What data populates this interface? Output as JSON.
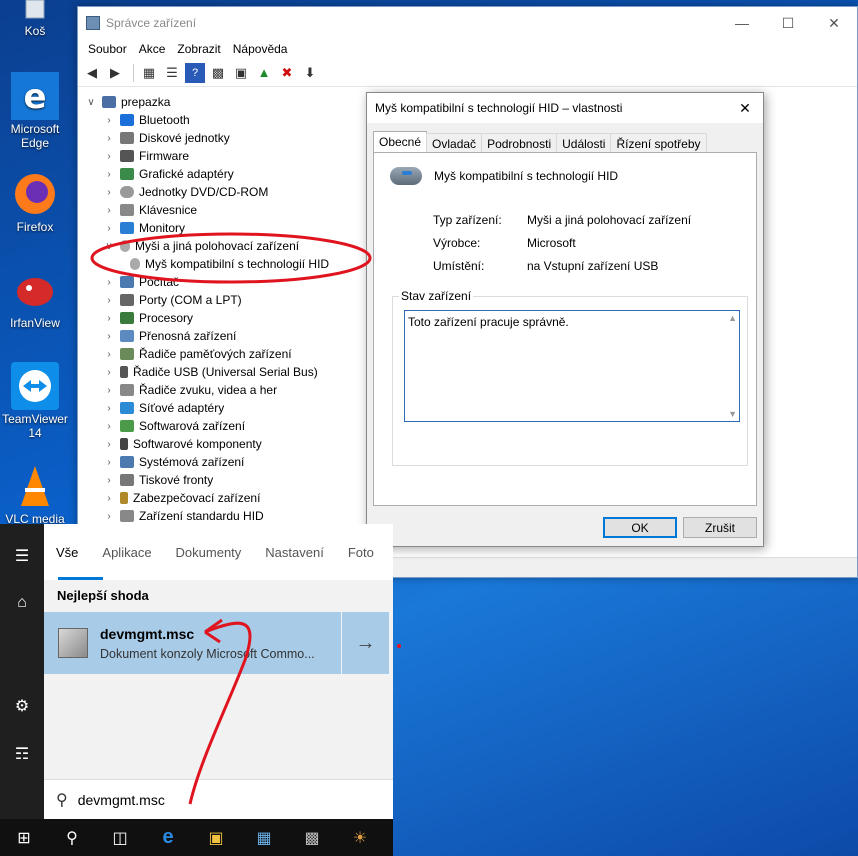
{
  "desktop": {
    "icons": [
      {
        "label": "Koš",
        "icon": "recycle-bin-icon"
      },
      {
        "label": "Microsoft Edge",
        "icon": "edge-icon"
      },
      {
        "label": "Firefox",
        "icon": "firefox-icon"
      },
      {
        "label": "IrfanView",
        "icon": "irfanview-icon"
      },
      {
        "label": "TeamViewer 14",
        "icon": "teamviewer-icon"
      },
      {
        "label": "VLC media",
        "icon": "vlc-icon"
      }
    ]
  },
  "devmgr": {
    "title": "Správce zařízení",
    "menu": [
      "Soubor",
      "Akce",
      "Zobrazit",
      "Nápověda"
    ],
    "root": "prepazka",
    "tree": [
      "Bluetooth",
      "Diskové jednotky",
      "Firmware",
      "Grafické adaptéry",
      "Jednotky DVD/CD-ROM",
      "Klávesnice",
      "Monitory",
      "Myši a jiná polohovací zařízení",
      "Myš kompatibilní s technologií HID",
      "Počítač",
      "Porty (COM a LPT)",
      "Procesory",
      "Přenosná zařízení",
      "Řadiče paměťových zařízení",
      "Řadiče USB (Universal Serial Bus)",
      "Řadiče zvuku, videa a her",
      "Síťové adaptéry",
      "Softwarová zařízení",
      "Softwarové komponenty",
      "Systémová zařízení",
      "Tiskové fronty",
      "Zabezpečovací zařízení",
      "Zařízení standardu HID"
    ]
  },
  "props": {
    "title": "Myš kompatibilní s technologií HID – vlastnosti",
    "tabs": [
      "Obecné",
      "Ovladač",
      "Podrobnosti",
      "Události",
      "Řízení spotřeby"
    ],
    "device_name": "Myš kompatibilní s technologií HID",
    "rows": [
      {
        "k": "Typ zařízení:",
        "v": "Myši a jiná polohovací zařízení"
      },
      {
        "k": "Výrobce:",
        "v": "Microsoft"
      },
      {
        "k": "Umístění:",
        "v": "na Vstupní zařízení USB"
      }
    ],
    "status_label": "Stav zařízení",
    "status_text": "Toto zařízení pracuje správně.",
    "ok": "OK",
    "cancel": "Zrušit"
  },
  "search": {
    "filters": [
      "Vše",
      "Aplikace",
      "Dokumenty",
      "Nastavení",
      "Foto"
    ],
    "best_label": "Nejlepší shoda",
    "result_name": "devmgmt.msc",
    "result_desc": "Dokument konzoly Microsoft Commo...",
    "query": "devmgmt.msc"
  },
  "colors": {
    "accent": "#0078d7",
    "annotation": "#e0141e",
    "highlight": "#a8cbe8"
  }
}
